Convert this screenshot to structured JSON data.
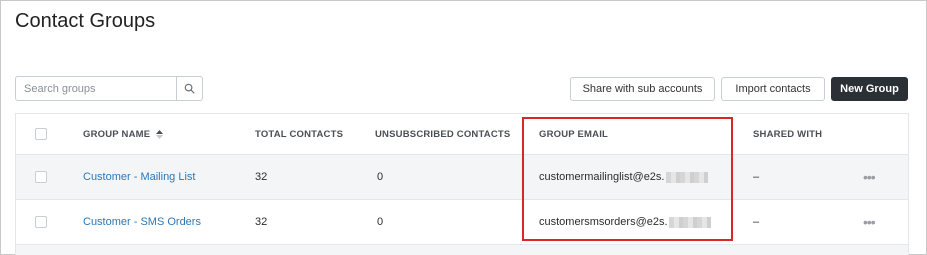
{
  "page": {
    "title": "Contact Groups"
  },
  "search": {
    "placeholder": "Search groups",
    "icon": "search-icon"
  },
  "toolbar": {
    "share_label": "Share with sub accounts",
    "import_label": "Import contacts",
    "new_group_label": "New Group"
  },
  "table": {
    "columns": {
      "group_name": "GROUP NAME",
      "total_contacts": "TOTAL CONTACTS",
      "unsubscribed_contacts": "UNSUBSCRIBED CONTACTS",
      "group_email": "GROUP EMAIL",
      "shared_with": "SHARED WITH"
    },
    "rows": [
      {
        "group_name": "Customer - Mailing List",
        "total_contacts": "32",
        "unsubscribed_contacts": "0",
        "group_email": "customermailinglist@e2s.",
        "shared_with": "–",
        "actions": "•••"
      },
      {
        "group_name": "Customer - SMS Orders",
        "total_contacts": "32",
        "unsubscribed_contacts": "0",
        "group_email": "customersmsorders@e2s.",
        "shared_with": "–",
        "actions": "•••"
      }
    ]
  },
  "colors": {
    "primary_button": "#2b3036",
    "link": "#2a78b8",
    "highlight_border": "#d9262a"
  }
}
